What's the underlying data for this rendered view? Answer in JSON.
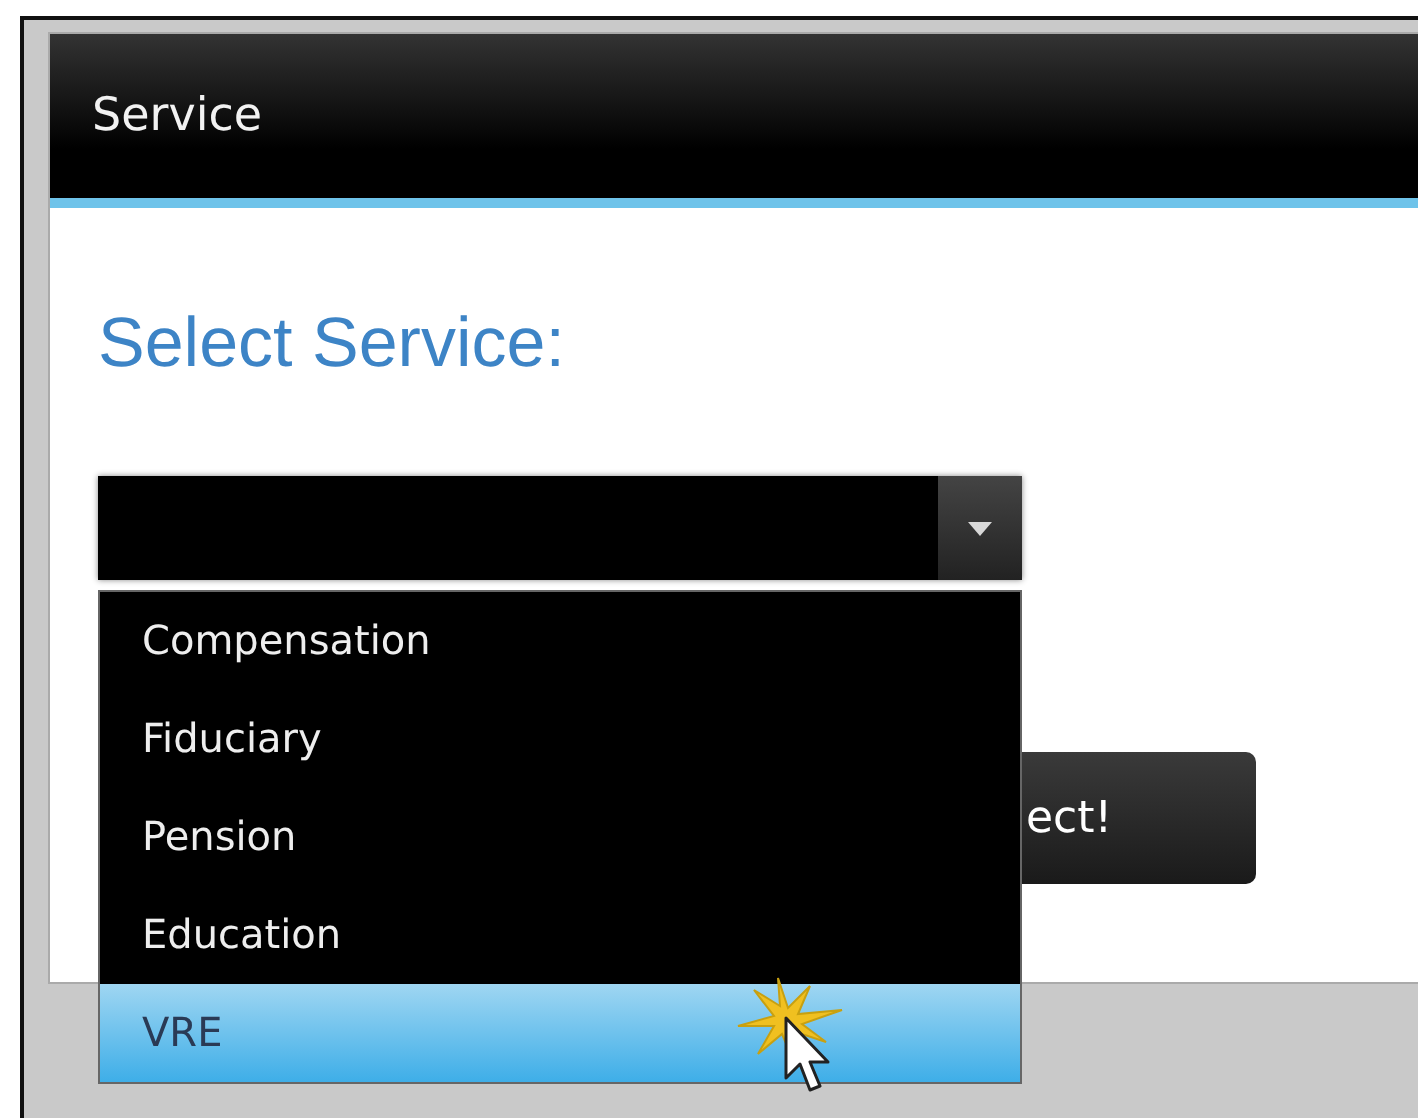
{
  "window": {
    "title": "Service"
  },
  "heading": "Select Service:",
  "dropdown": {
    "expanded": true,
    "options": [
      {
        "label": "Compensation",
        "selected": false
      },
      {
        "label": "Fiduciary",
        "selected": false
      },
      {
        "label": "Pension",
        "selected": false
      },
      {
        "label": "Education",
        "selected": false
      },
      {
        "label": "VRE",
        "selected": true
      }
    ]
  },
  "button": {
    "label": "ect!"
  }
}
